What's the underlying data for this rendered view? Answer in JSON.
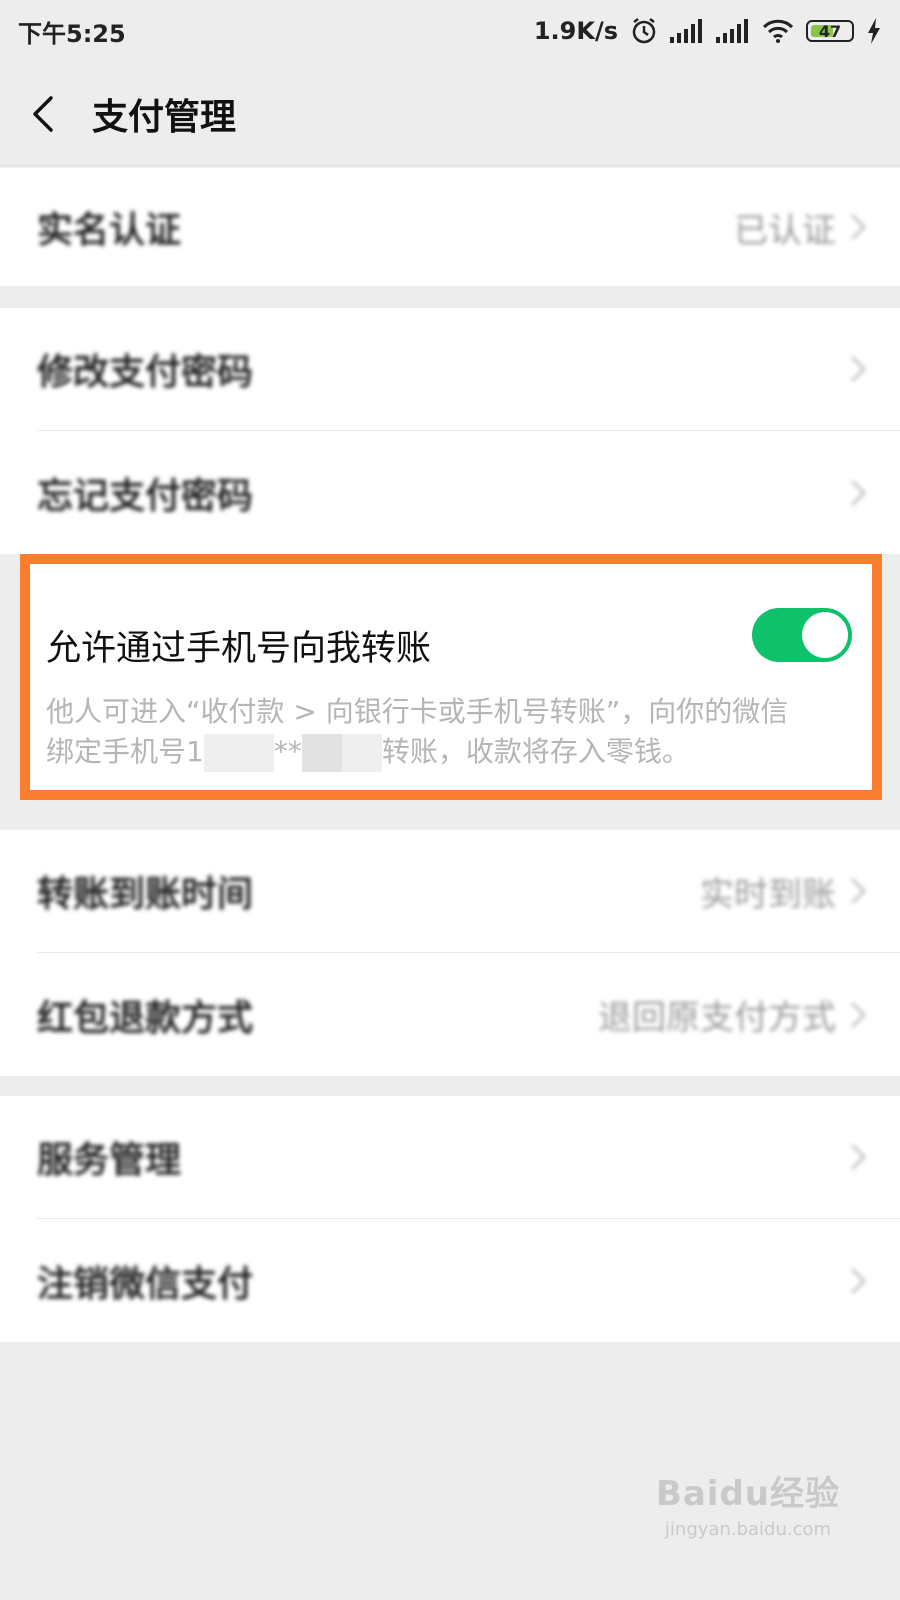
{
  "status_bar": {
    "time": "下午5:25",
    "speed": "1.9K/s",
    "battery": "47"
  },
  "nav": {
    "title": "支付管理"
  },
  "rows": {
    "real_name": {
      "label": "实名认证",
      "value": "已认证"
    },
    "change_pwd": {
      "label": "修改支付密码"
    },
    "forgot_pwd": {
      "label": "忘记支付密码"
    },
    "transfer_time": {
      "label": "转账到账时间",
      "value": "实时到账"
    },
    "refund": {
      "label": "红包退款方式",
      "value": "退回原支付方式"
    },
    "service": {
      "label": "服务管理"
    },
    "cancel": {
      "label": "注销微信支付"
    }
  },
  "phone_transfer": {
    "label": "允许通过手机号向我转账",
    "enabled": true,
    "desc_line1": "他人可进入“收付款 > 向银行卡或手机号转账”，向你的微信",
    "desc_line2_prefix": "绑定手机号1",
    "desc_line2_mid": "**",
    "desc_line2_suffix": "转账，收款将存入零钱。"
  },
  "colors": {
    "toggle_on": "#0ec16a",
    "highlight": "#fa7d30",
    "background": "#ededed"
  },
  "watermark": {
    "logo": "Baidu经验",
    "url": "jingyan.baidu.com"
  }
}
